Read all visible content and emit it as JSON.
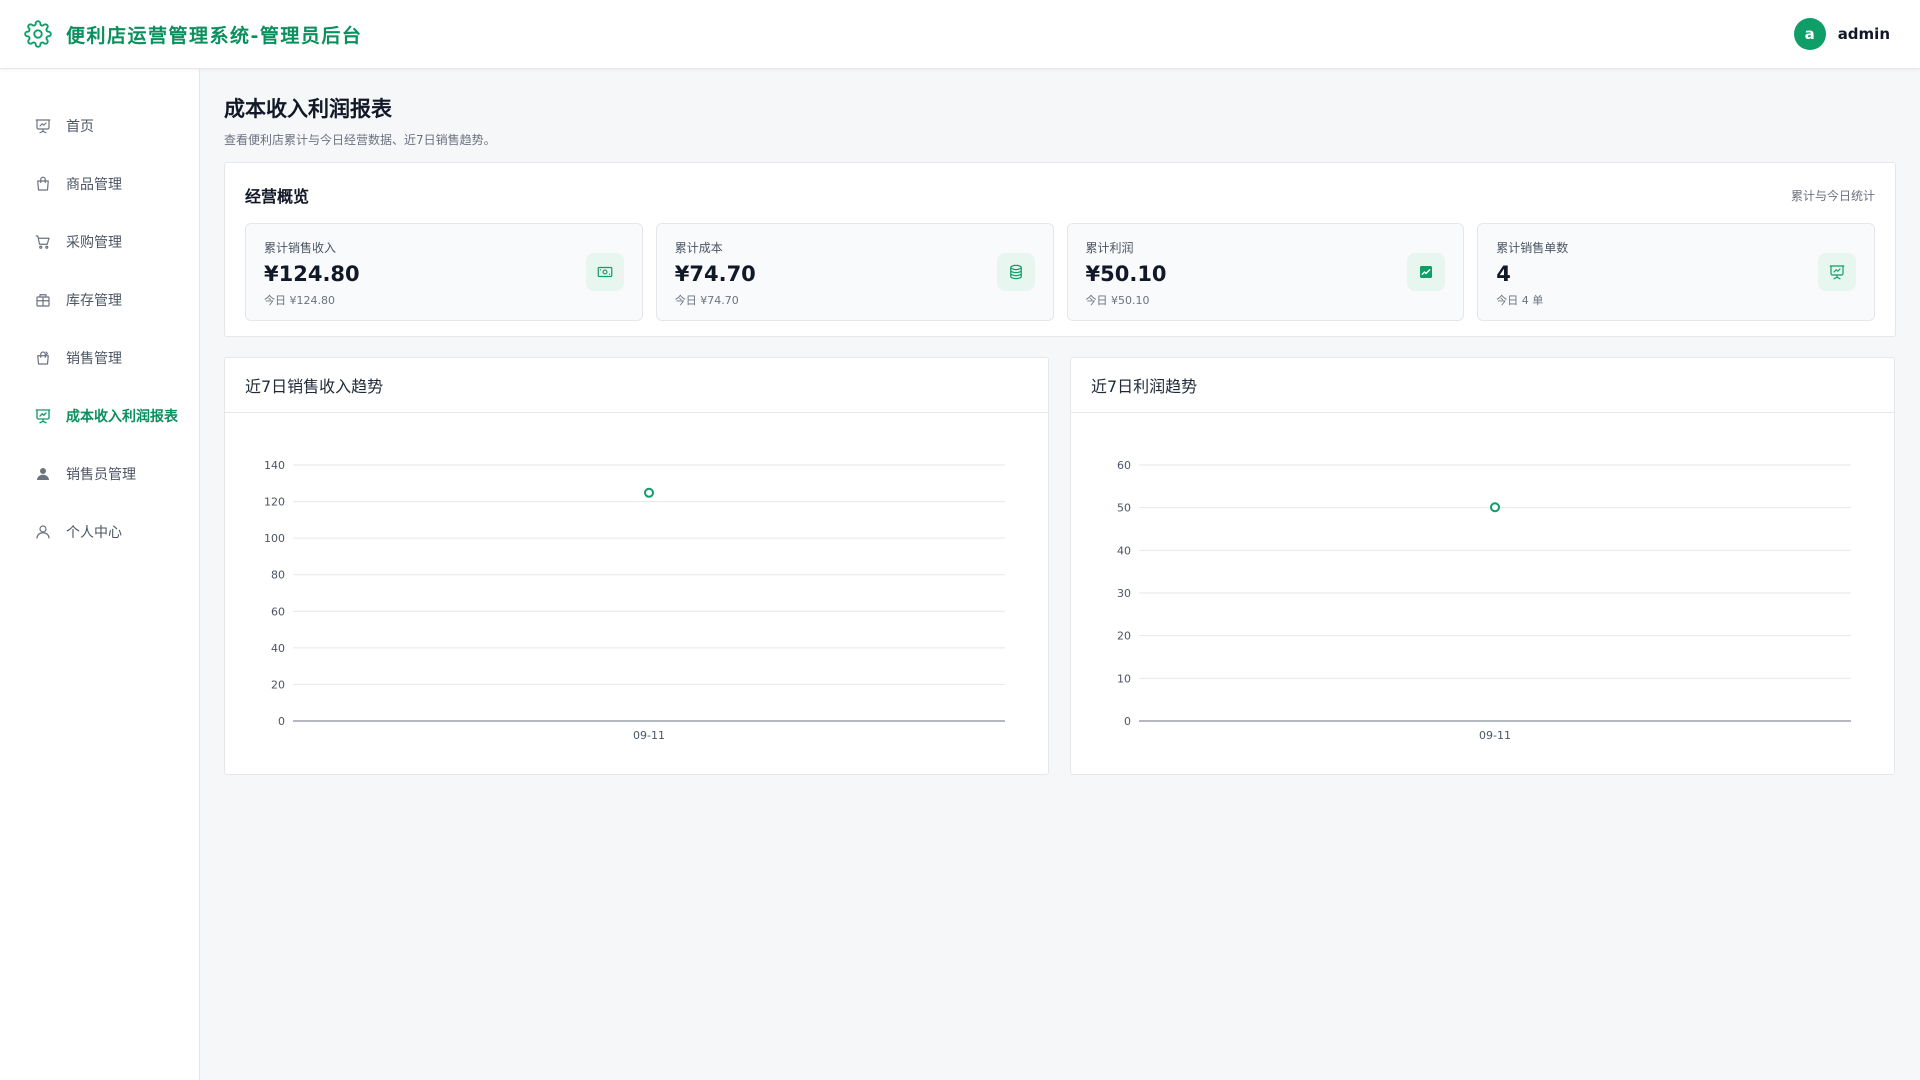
{
  "header": {
    "title": "便利店运营管理系统-管理员后台",
    "avatar_letter": "a",
    "username": "admin"
  },
  "sidebar": {
    "items": [
      {
        "label": "首页",
        "icon": "presentation-chart-icon",
        "active": false
      },
      {
        "label": "商品管理",
        "icon": "shopping-bag-icon",
        "active": false
      },
      {
        "label": "采购管理",
        "icon": "shopping-cart-icon",
        "active": false
      },
      {
        "label": "库存管理",
        "icon": "inventory-box-icon",
        "active": false
      },
      {
        "label": "销售管理",
        "icon": "sales-bag-icon",
        "active": false
      },
      {
        "label": "成本收入利润报表",
        "icon": "report-chart-icon",
        "active": true
      },
      {
        "label": "销售员管理",
        "icon": "user-solid-icon",
        "active": false
      },
      {
        "label": "个人中心",
        "icon": "user-outline-icon",
        "active": false
      }
    ]
  },
  "page": {
    "title": "成本收入利润报表",
    "subtitle": "查看便利店累计与今日经营数据、近7日销售趋势。"
  },
  "overview": {
    "title": "经营概览",
    "note": "累计与今日统计",
    "stats": [
      {
        "label": "累计销售收入",
        "value": "¥124.80",
        "today": "今日 ¥124.80",
        "icon": "cash-icon"
      },
      {
        "label": "累计成本",
        "value": "¥74.70",
        "today": "今日 ¥74.70",
        "icon": "coin-stack-icon"
      },
      {
        "label": "累计利润",
        "value": "¥50.10",
        "today": "今日 ¥50.10",
        "icon": "trend-chart-icon"
      },
      {
        "label": "累计销售单数",
        "value": "4",
        "today": "今日 4 单",
        "icon": "order-board-icon"
      }
    ]
  },
  "colors": {
    "accent": "#0f9d68",
    "brand_text": "#0a8f5e"
  },
  "chart_data": [
    {
      "type": "line",
      "title": "近7日销售收入趋势",
      "categories": [
        "09-11"
      ],
      "series": [
        {
          "values": [
            124.8
          ]
        }
      ],
      "ylim": [
        0,
        140
      ],
      "yticks": [
        0,
        20,
        40,
        60,
        80,
        100,
        120,
        140
      ],
      "grid": true
    },
    {
      "type": "line",
      "title": "近7日利润趋势",
      "categories": [
        "09-11"
      ],
      "series": [
        {
          "values": [
            50.1
          ]
        }
      ],
      "ylim": [
        0,
        60
      ],
      "yticks": [
        0,
        10,
        20,
        30,
        40,
        50,
        60
      ],
      "grid": true
    }
  ]
}
